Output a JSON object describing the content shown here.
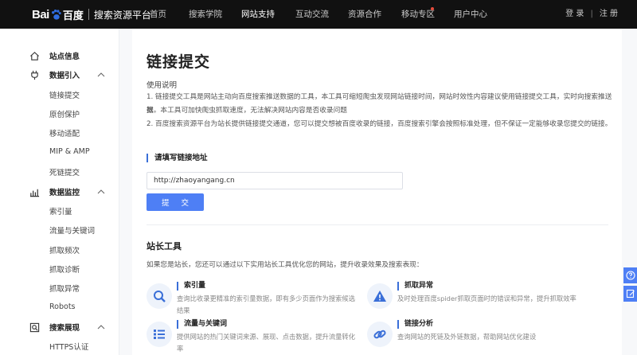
{
  "header": {
    "logo_bai": "Bai",
    "logo_du": "百度",
    "logo_sub": "搜索资源平台",
    "nav": [
      {
        "label": "首页"
      },
      {
        "label": "搜索学院"
      },
      {
        "label": "网站支持"
      },
      {
        "label": "互动交流"
      },
      {
        "label": "资源合作"
      },
      {
        "label": "移动专区"
      },
      {
        "label": "用户中心"
      }
    ],
    "login": "登 录",
    "sep": "|",
    "register": "注 册"
  },
  "sidebar": {
    "site_info": "站点信息",
    "groups": [
      {
        "label": "数据引入",
        "items": [
          "链接提交",
          "原创保护",
          "移动适配",
          "MIP & AMP",
          "死链提交"
        ]
      },
      {
        "label": "数据监控",
        "items": [
          "索引量",
          "流量与关键词",
          "抓取频次",
          "抓取诊断",
          "抓取异常",
          "Robots"
        ]
      },
      {
        "label": "搜索展现",
        "items": [
          "HTTPS认证"
        ]
      }
    ]
  },
  "main": {
    "title": "链接提交",
    "usage_heading": "使用说明",
    "usage_1a": "1. 链接提交工具是网站主动向百度搜索推送数据的工具，本工具可缩短爬虫发现网站链接时间，网站时效性内容建议使用链接提交工具，实时向搜索推送数",
    "usage_1b": "据。本工具可加快爬虫抓取速度，无法解决网站内容是否收录问题",
    "usage_2": "2. 百度搜索资源平台为站长提供链接提交通道，您可以提交想被百度收录的链接，百度搜索引擎会按照标准处理，但不保证一定能够收录您提交的链接。",
    "form_heading": "请填写链接地址",
    "url_value": "http://zhaoyangang.cn",
    "submit_label": "提 交",
    "tools_heading": "站长工具",
    "tools_desc": "如果您是站长，您还可以通过以下实用站长工具优化您的网站，提升收录效果及搜索表现：",
    "tools": [
      {
        "name": "索引量",
        "desc": "查询比收录更精准的索引量数据，即有多少页面作为搜索候选结果",
        "icon": "search-icon"
      },
      {
        "name": "抓取异常",
        "desc": "及时处理百度spider抓取页面时的错误和异常，提升抓取效率",
        "icon": "warning-icon"
      },
      {
        "name": "流量与关键词",
        "desc": "提供网站的热门关键词来源、展现、点击数据，提升流量转化率",
        "icon": "list-icon"
      },
      {
        "name": "链接分析",
        "desc": "查询网站的死链及外链数据，帮助网站优化建设",
        "icon": "link-icon"
      }
    ]
  },
  "colors": {
    "accent": "#4e7ff5",
    "topbar": "#111111"
  }
}
